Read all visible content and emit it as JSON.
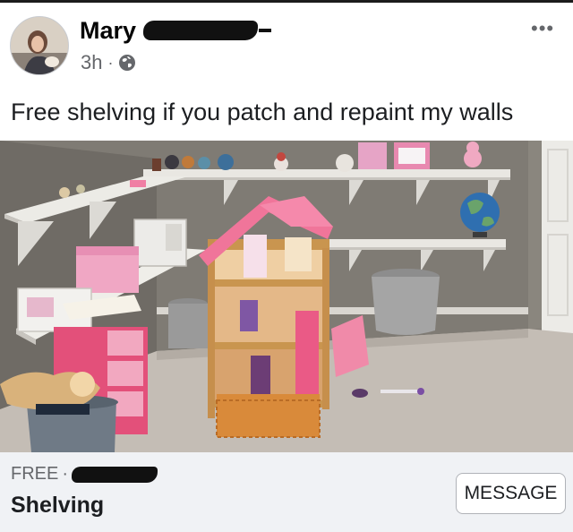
{
  "post": {
    "author_name": "Mary",
    "time": "3h",
    "separator": "·",
    "privacy_icon": "globe-icon",
    "more_icon": "more-options-icon",
    "more_label": "•••",
    "caption": "Free shelving if you patch and repaint my walls",
    "photo_description_icon": "room-photo"
  },
  "listing": {
    "price": "FREE",
    "price_separator": "·",
    "title": "Shelving",
    "message_button": "MESSAGE"
  },
  "colors": {
    "wall": "#7f7b74",
    "shelf": "#e9e7e2",
    "carpet": "#c4bdb5",
    "dollhouse_roof": "#f0759a",
    "bin": "#e3507a"
  }
}
